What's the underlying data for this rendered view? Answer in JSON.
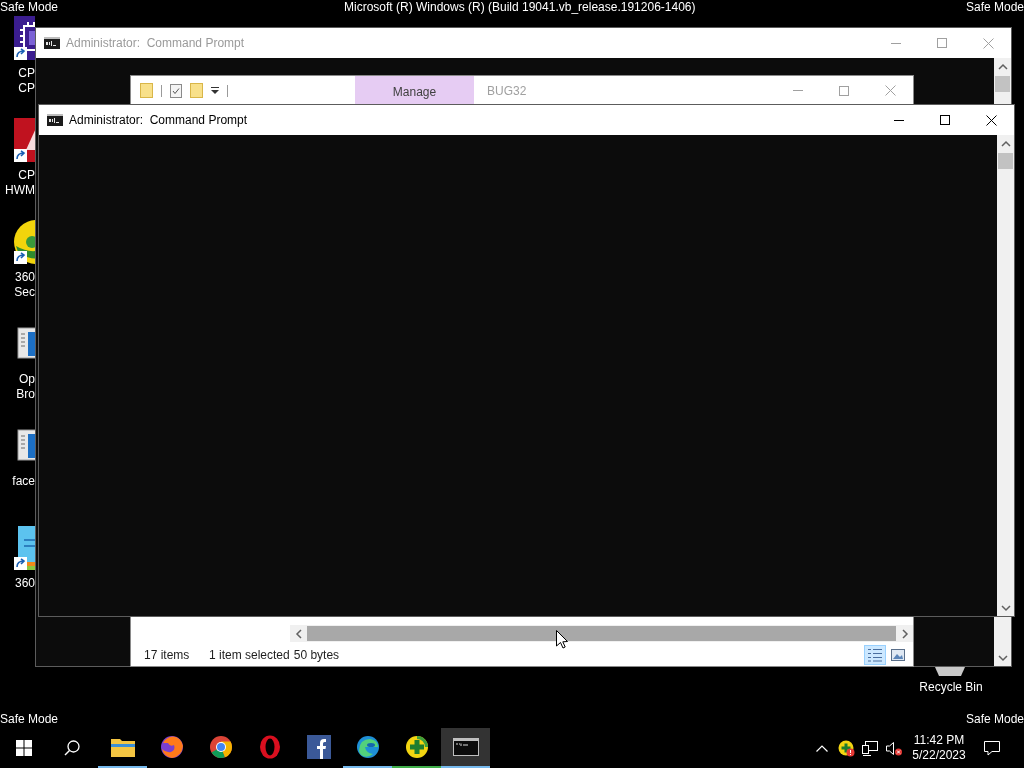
{
  "overlay": {
    "top_left": "Safe Mode",
    "top_center": "Microsoft (R) Windows (R) (Build 19041.vb_release.191206-1406)",
    "top_right": "Safe Mode",
    "bottom_left": "Safe Mode",
    "bottom_right": "Safe Mode"
  },
  "desktop_icons": [
    {
      "kind": "chip",
      "shortcut": true,
      "label_lines": [
        "CP",
        "CP"
      ]
    },
    {
      "kind": "tile",
      "shortcut": true,
      "label_lines": [
        "CP",
        "HWM"
      ]
    },
    {
      "kind": "badge",
      "shortcut": true,
      "label_lines": [
        "360",
        "Sec"
      ]
    },
    {
      "kind": "document",
      "shortcut": false,
      "label_lines": [
        "Op",
        "Bro"
      ]
    },
    {
      "kind": "document",
      "shortcut": false,
      "label_lines": [
        "face"
      ]
    },
    {
      "kind": "archive",
      "shortcut": true,
      "label_lines": [
        "360"
      ]
    }
  ],
  "recycle_bin": {
    "label": "Recycle Bin"
  },
  "back_console": {
    "title": "Administrator:  Command Prompt",
    "active": false
  },
  "explorer": {
    "active": false,
    "context_tab": "Manage",
    "title": "BUG32",
    "status": {
      "item_count": "17 items",
      "selection": "1 item selected",
      "size": "50 bytes"
    },
    "views": [
      {
        "kind": "details",
        "selected": true
      },
      {
        "kind": "large_icons",
        "selected": false
      }
    ]
  },
  "front_console": {
    "title": "Administrator:  Command Prompt",
    "active": true
  },
  "taskbar": {
    "apps": [
      {
        "kind": "folder",
        "running": true,
        "active": false,
        "color": "#76b9ed"
      },
      {
        "kind": "globe",
        "running": false,
        "active": false
      },
      {
        "kind": "segments",
        "running": false,
        "active": false
      },
      {
        "kind": "ring",
        "running": false,
        "active": false
      },
      {
        "kind": "square_logo",
        "running": false,
        "active": false
      },
      {
        "kind": "swirl",
        "running": true,
        "active": false,
        "color": "#76b9ed"
      },
      {
        "kind": "plus_circle",
        "running": true,
        "active": false,
        "color": "#3fae49"
      },
      {
        "kind": "terminal",
        "running": true,
        "active": true,
        "color": "#76b9ed"
      }
    ],
    "volume_muted": true,
    "clock_time": "11:42 PM",
    "clock_date": "5/22/2023"
  }
}
